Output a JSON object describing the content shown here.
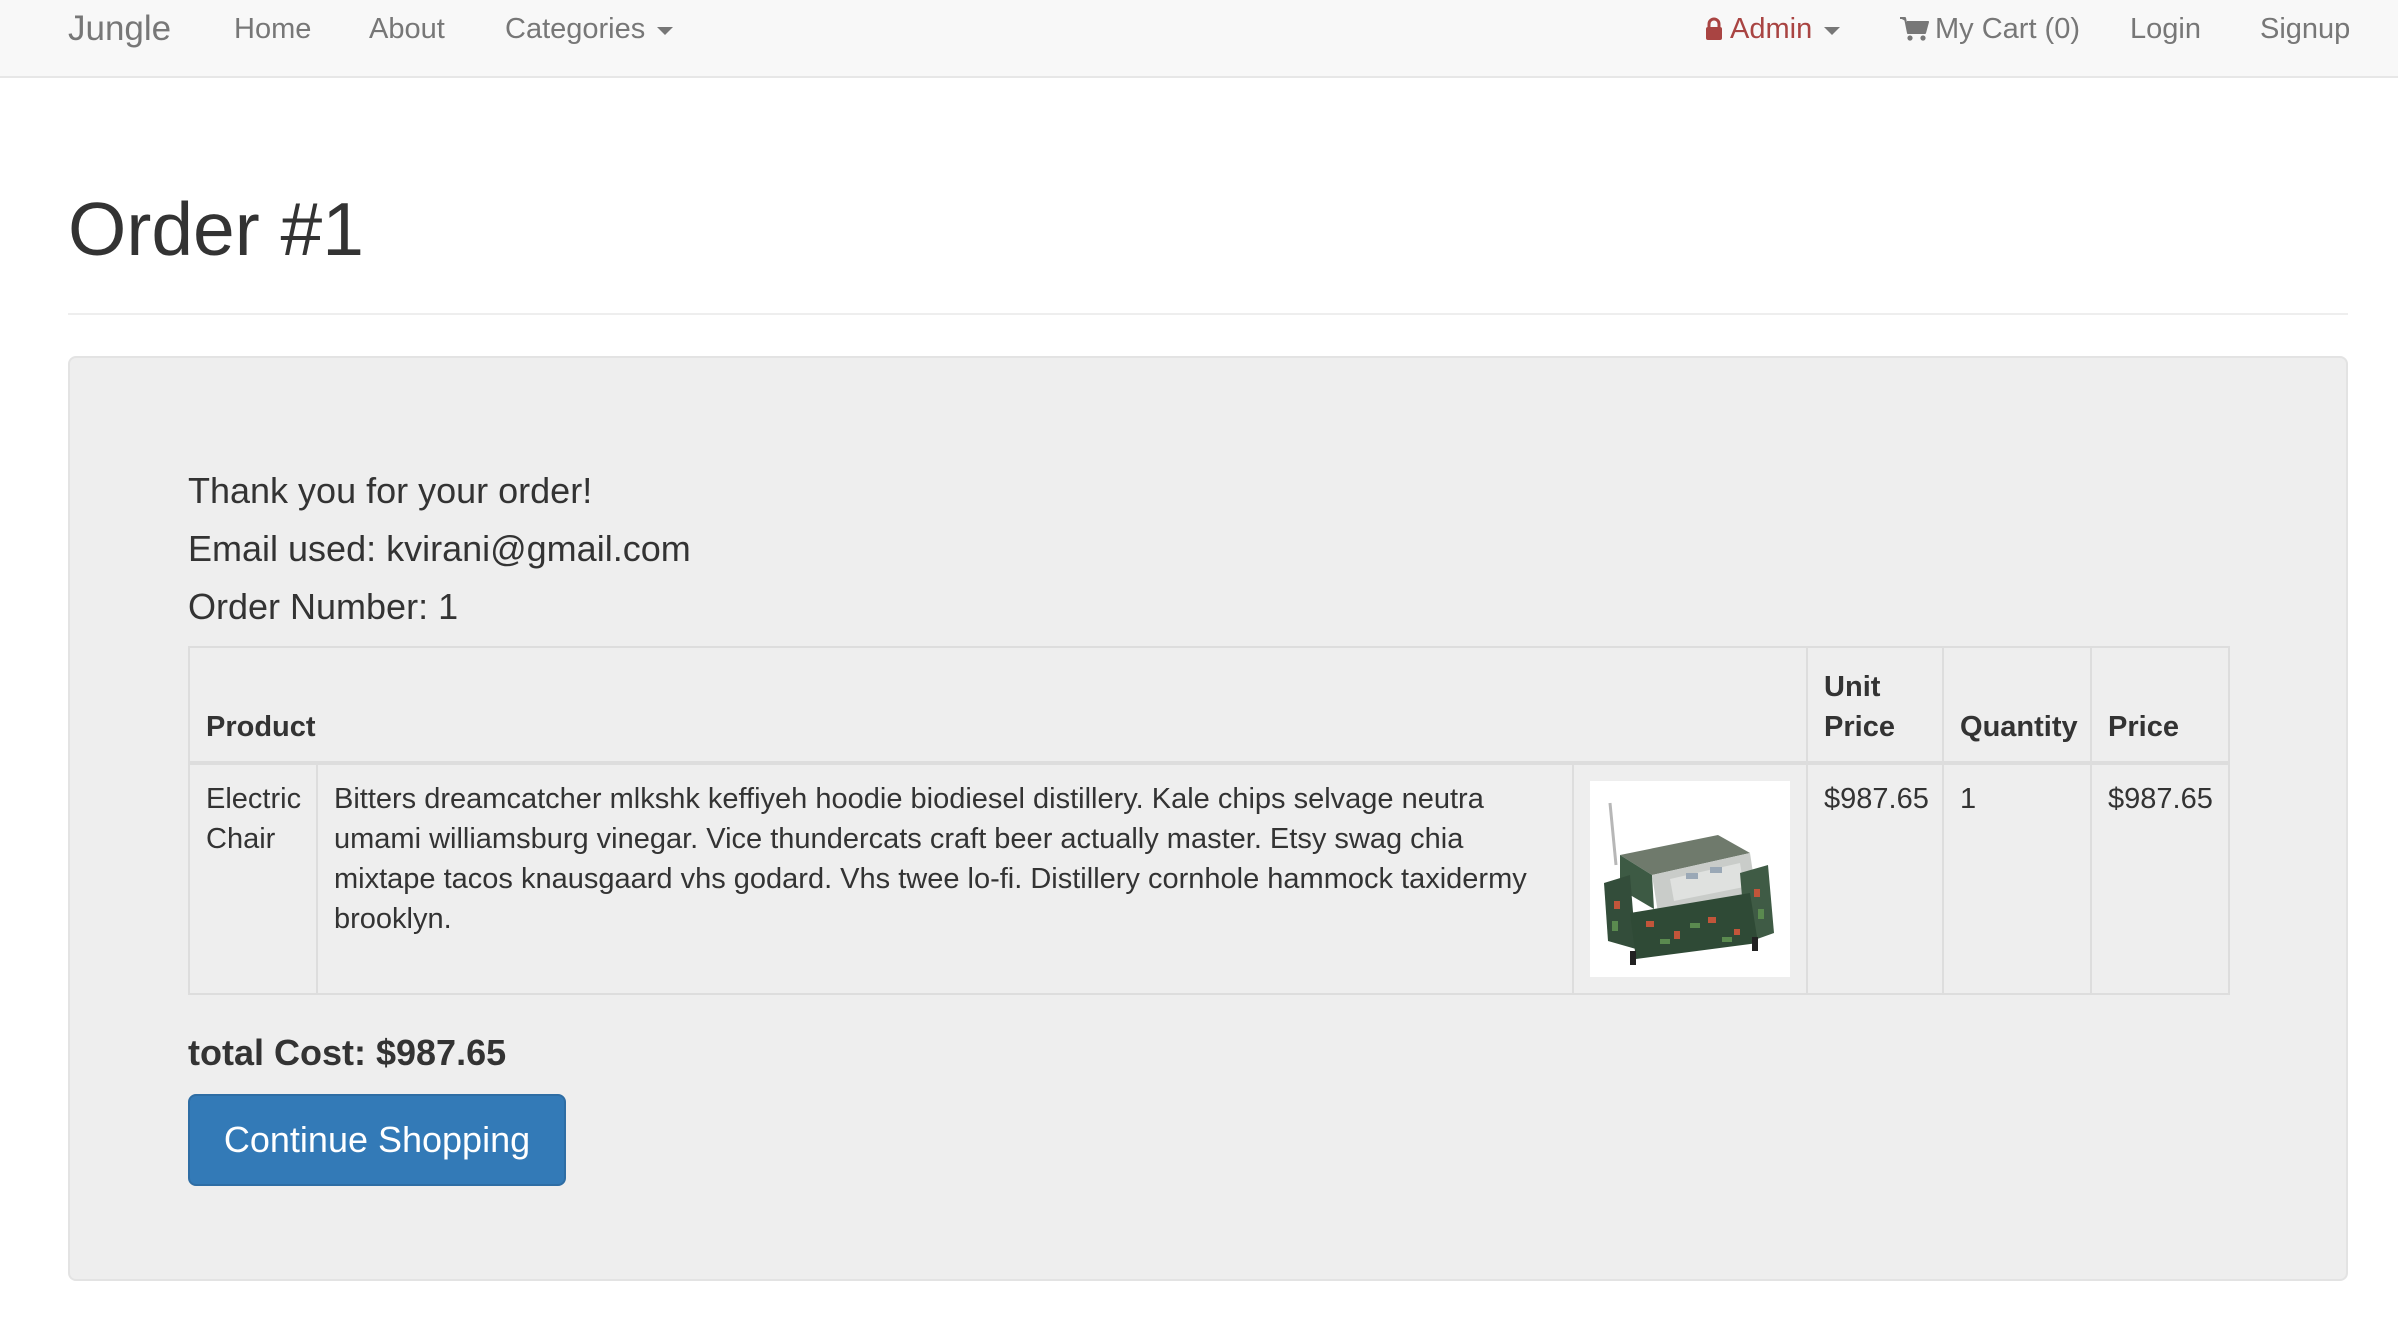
{
  "navbar": {
    "brand": "Jungle",
    "home": "Home",
    "about": "About",
    "categories": "Categories",
    "admin": "Admin",
    "cart": "My Cart (0)",
    "login": "Login",
    "signup": "Signup",
    "icons": {
      "admin": "lock-icon",
      "cart": "shopping-cart-icon",
      "dropdown": "caret-down-icon"
    },
    "colors": {
      "admin": "#a94442",
      "link": "#777777"
    }
  },
  "page": {
    "title": "Order #1"
  },
  "summary": {
    "thanks": "Thank you for your order!",
    "email": "Email used: kvirani@gmail.com",
    "order_number": "Order Number: 1"
  },
  "table": {
    "headers": {
      "product": "Product",
      "unit_price": "Unit Price",
      "quantity": "Quantity",
      "price": "Price"
    },
    "rows": [
      {
        "name": "Electric Chair",
        "description": "Bitters dreamcatcher mlkshk keffiyeh hoodie biodiesel distillery. Kale chips selvage neutra umami williamsburg vinegar. Vice thundercats craft beer actually master. Etsy swag chia mixtape tacos knausgaard vhs godard. Vhs twee lo-fi. Distillery cornhole hammock taxidermy brooklyn.",
        "image": "electric-chair-product-image",
        "unit_price": "$987.65",
        "quantity": "1",
        "price": "$987.65"
      }
    ]
  },
  "footer": {
    "total": "total Cost: $987.65",
    "continue_button": "Continue Shopping",
    "button_color": "#337ab7"
  }
}
